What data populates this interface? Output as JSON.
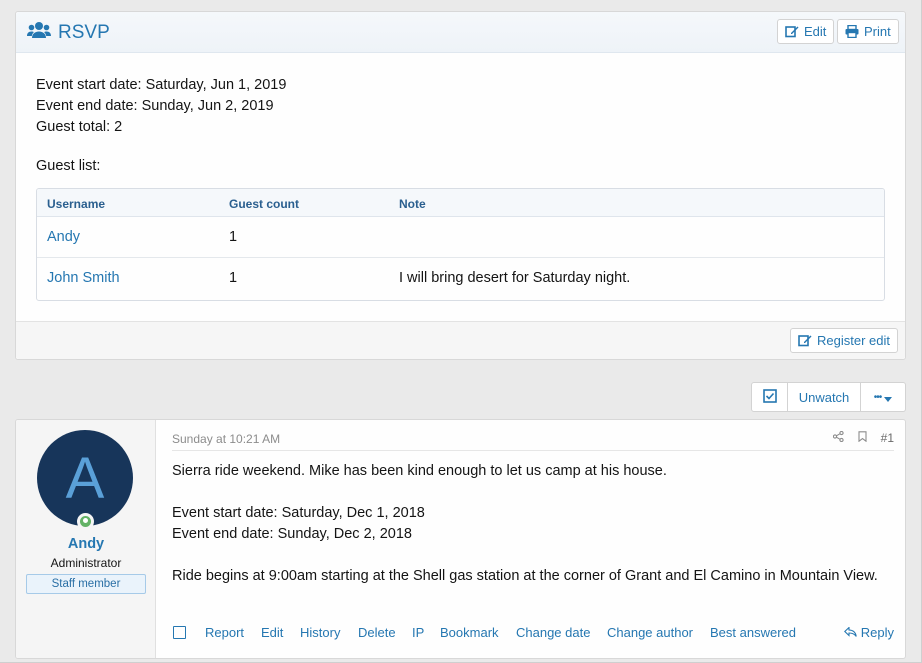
{
  "rsvp": {
    "title": "RSVP",
    "edit_label": "Edit",
    "print_label": "Print",
    "start_line": "Event start date: Saturday, Jun 1, 2019",
    "end_line": "Event end date: Sunday, Jun 2, 2019",
    "total_line": "Guest total: 2",
    "guest_list_label": "Guest list:",
    "table": {
      "columns": [
        "Username",
        "Guest count",
        "Note"
      ],
      "rows": [
        {
          "username": "Andy",
          "count": "1",
          "note": ""
        },
        {
          "username": "John Smith",
          "count": "1",
          "note": "I will bring desert for Saturday night."
        }
      ]
    },
    "register_edit_label": "Register edit"
  },
  "watch": {
    "unwatch_label": "Unwatch",
    "more_label": "•••"
  },
  "post": {
    "avatar_letter": "A",
    "username": "Andy",
    "user_title": "Administrator",
    "user_banner": "Staff member",
    "date": "Sunday at 10:21 AM",
    "post_number": "#1",
    "body": [
      "Sierra ride weekend. Mike has been kind enough to let us camp at his house.",
      "Event start date: Saturday, Dec 1, 2018",
      "Event end date: Sunday, Dec 2, 2018",
      "Ride begins at 9:00am starting at the Shell gas station at the corner of Grant and El Camino in Mountain View."
    ],
    "actions": [
      "Report",
      "Edit",
      "History",
      "Delete",
      "IP",
      "Bookmark",
      "Change date",
      "Change author",
      "Best answered"
    ],
    "reply_label": "Reply"
  },
  "colors": {
    "link": "#2577b1",
    "avatar_bg": "#17355a",
    "online": "#63b265"
  }
}
